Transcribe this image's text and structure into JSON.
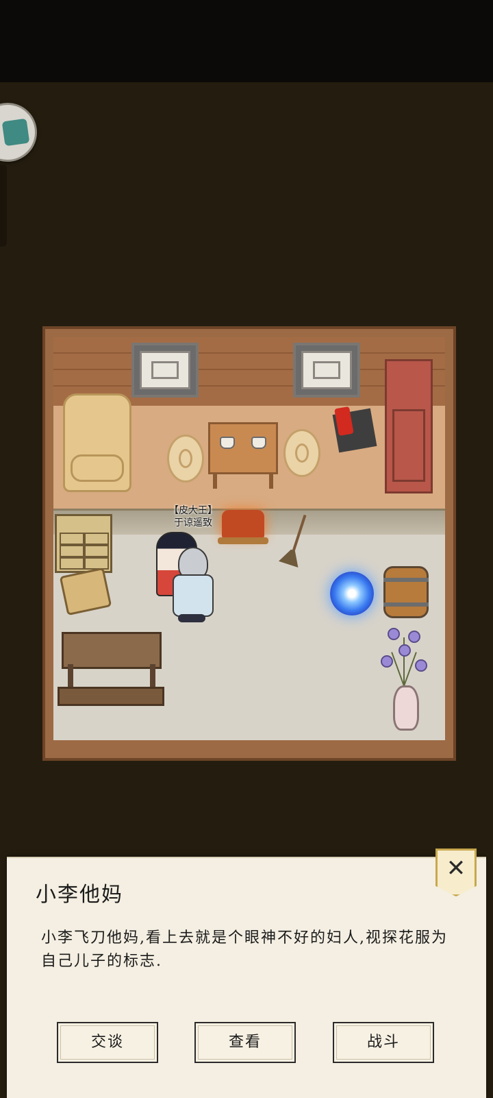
{
  "scene": {
    "npc_title": "【皮大王】",
    "npc_name": "于谅遥致"
  },
  "dialog": {
    "title": "小李他妈",
    "description": "小李飞刀他妈,看上去就是个眼神不好的妇人,视探花服为自己儿子的标志.",
    "close_label": "✕",
    "actions": [
      "交谈",
      "查看",
      "战斗"
    ]
  },
  "icons": [
    "close-icon",
    "portal-icon"
  ],
  "colors": {
    "background": "#241d0f",
    "panel": "#f4efe2",
    "close_border": "#c8a84e",
    "portal": "#3a7bf0"
  }
}
